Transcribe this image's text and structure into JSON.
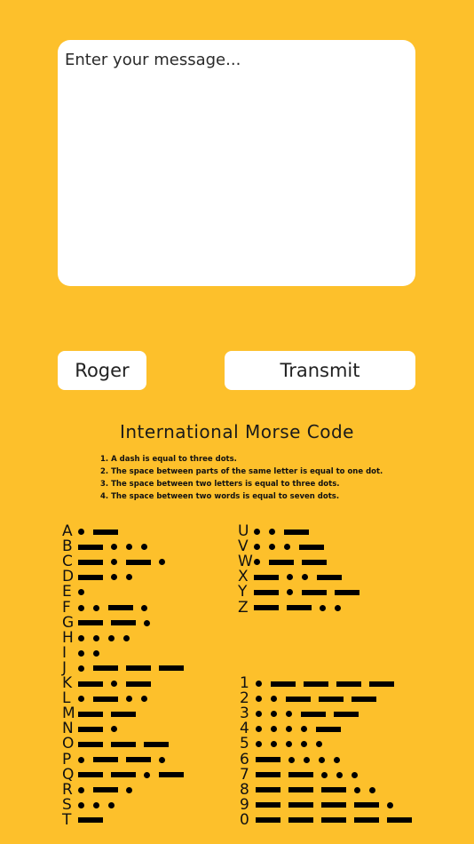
{
  "message": {
    "placeholder": "Enter your message..."
  },
  "buttons": {
    "roger": "Roger",
    "transmit": "Transmit"
  },
  "chart": {
    "title": "International Morse Code",
    "rules": [
      "1. A dash is equal to three dots.",
      "2. The space between parts of the same letter is equal to one dot.",
      "3. The space between two letters is equal to three dots.",
      "4. The space between two words is equal to seven dots."
    ]
  },
  "colors": {
    "background": "#FDC02B",
    "panel": "#FFFFFF",
    "ink": "#000000"
  },
  "morse": {
    "letters_left": [
      {
        "char": "A",
        "code": ".-"
      },
      {
        "char": "B",
        "code": "-..."
      },
      {
        "char": "C",
        "code": "-.-."
      },
      {
        "char": "D",
        "code": "-.."
      },
      {
        "char": "E",
        "code": "."
      },
      {
        "char": "F",
        "code": "..-."
      },
      {
        "char": "G",
        "code": "--."
      },
      {
        "char": "H",
        "code": "...."
      },
      {
        "char": "I",
        "code": ".."
      },
      {
        "char": "J",
        "code": ".---"
      },
      {
        "char": "K",
        "code": "-.-"
      },
      {
        "char": "L",
        "code": ".-.."
      },
      {
        "char": "M",
        "code": "--"
      },
      {
        "char": "N",
        "code": "-."
      },
      {
        "char": "O",
        "code": "---"
      },
      {
        "char": "P",
        "code": ".--."
      },
      {
        "char": "Q",
        "code": "--.-"
      },
      {
        "char": "R",
        "code": ".-."
      },
      {
        "char": "S",
        "code": "..."
      },
      {
        "char": "T",
        "code": "-"
      }
    ],
    "letters_right": [
      {
        "char": "U",
        "code": "..-"
      },
      {
        "char": "V",
        "code": "...-"
      },
      {
        "char": "W",
        "code": ".--"
      },
      {
        "char": "X",
        "code": "-..-"
      },
      {
        "char": "Y",
        "code": "-.--"
      },
      {
        "char": "Z",
        "code": "--.."
      }
    ],
    "digits": [
      {
        "char": "1",
        "code": ".----"
      },
      {
        "char": "2",
        "code": "..---"
      },
      {
        "char": "3",
        "code": "...--"
      },
      {
        "char": "4",
        "code": "....-"
      },
      {
        "char": "5",
        "code": "....."
      },
      {
        "char": "6",
        "code": "-...."
      },
      {
        "char": "7",
        "code": "--..."
      },
      {
        "char": "8",
        "code": "---.."
      },
      {
        "char": "9",
        "code": "----."
      },
      {
        "char": "0",
        "code": "-----"
      }
    ]
  }
}
